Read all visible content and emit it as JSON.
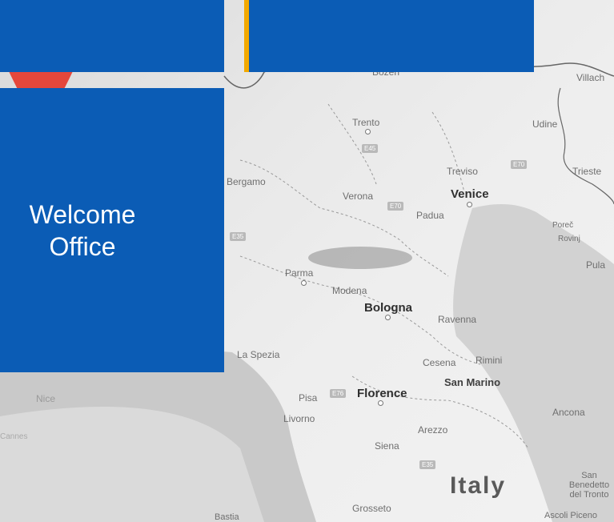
{
  "panel": {
    "welcome_line1": "Welcome",
    "welcome_line2": "Office",
    "brand_color": "#0b5cb5",
    "accent_color": "#f2a900"
  },
  "map": {
    "marker": {
      "icon": "map-pin-icon",
      "color": "#e5473b",
      "location": "Parma"
    },
    "cities": [
      {
        "name": "Bozen",
        "type": "city"
      },
      {
        "name": "Villach",
        "type": "city"
      },
      {
        "name": "Trento",
        "type": "city"
      },
      {
        "name": "Udine",
        "type": "city"
      },
      {
        "name": "Treviso",
        "type": "city"
      },
      {
        "name": "Trieste",
        "type": "city"
      },
      {
        "name": "Verona",
        "type": "city"
      },
      {
        "name": "Venice",
        "type": "major"
      },
      {
        "name": "Padua",
        "type": "city"
      },
      {
        "name": "Bergamo",
        "type": "city"
      },
      {
        "name": "Parma",
        "type": "city"
      },
      {
        "name": "Poreč",
        "type": "city"
      },
      {
        "name": "Rovinj",
        "type": "city"
      },
      {
        "name": "Pula",
        "type": "city"
      },
      {
        "name": "Modena",
        "type": "city"
      },
      {
        "name": "Bologna",
        "type": "major"
      },
      {
        "name": "Ravenna",
        "type": "city"
      },
      {
        "name": "La Spezia",
        "type": "city"
      },
      {
        "name": "Cesena",
        "type": "city"
      },
      {
        "name": "Rimini",
        "type": "city"
      },
      {
        "name": "San Marino",
        "type": "major"
      },
      {
        "name": "Nice",
        "type": "city"
      },
      {
        "name": "Pisa",
        "type": "city"
      },
      {
        "name": "Florence",
        "type": "major"
      },
      {
        "name": "Livorno",
        "type": "city"
      },
      {
        "name": "Cannes",
        "type": "city"
      },
      {
        "name": "Ancona",
        "type": "city"
      },
      {
        "name": "Arezzo",
        "type": "city"
      },
      {
        "name": "Siena",
        "type": "city"
      },
      {
        "name": "San Benedetto del Tronto",
        "type": "city"
      },
      {
        "name": "Grosseto",
        "type": "city"
      },
      {
        "name": "Bastia",
        "type": "city"
      },
      {
        "name": "Ascoli Piceno",
        "type": "city"
      }
    ],
    "country": "Italy",
    "roads": [
      "E45",
      "E70",
      "E35",
      "E70",
      "E76",
      "E35"
    ]
  }
}
